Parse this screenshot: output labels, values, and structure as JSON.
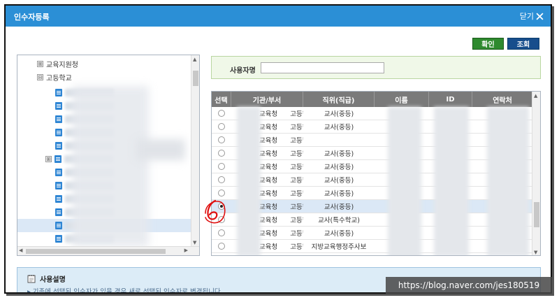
{
  "window": {
    "title": "인수자등록",
    "close_label": "닫기"
  },
  "buttons": {
    "confirm": "확인",
    "search": "조회"
  },
  "tree": {
    "items": [
      {
        "label": "교육지원청",
        "expander": "⊞"
      },
      {
        "label": "고등학교",
        "expander": "⊟"
      }
    ],
    "sub_expander": "⊞"
  },
  "search": {
    "label": "사용자명",
    "value": ""
  },
  "grid": {
    "columns": [
      "선택",
      "기관/부서",
      "직위(직급)",
      "이름",
      "ID",
      "연락처"
    ],
    "rows": [
      {
        "selected": false,
        "org1": "교육청",
        "org2": "고등학",
        "position": "교사(중등)"
      },
      {
        "selected": false,
        "org1": "교육청",
        "org2": "고등학",
        "position": "교사(중등)"
      },
      {
        "selected": false,
        "org1": "교육청",
        "org2": "고등학",
        "position": ""
      },
      {
        "selected": false,
        "org1": "교육청",
        "org2": "고등학",
        "position": "교사(중등)"
      },
      {
        "selected": false,
        "org1": "교육청",
        "org2": "고등학",
        "position": "교사(중등)"
      },
      {
        "selected": false,
        "org1": "교육청",
        "org2": "고등학",
        "position": "교사(중등)"
      },
      {
        "selected": false,
        "org1": "교육청",
        "org2": "고등학",
        "position": "교사(중등)"
      },
      {
        "selected": true,
        "org1": "교육청",
        "org2": "고등학",
        "position": "교사(중등)"
      },
      {
        "selected": false,
        "org1": "교육청",
        "org2": "고등학",
        "position": "교사(특수학교)"
      },
      {
        "selected": false,
        "org1": "교육청",
        "org2": "고등학",
        "position": "교사(중등)"
      },
      {
        "selected": false,
        "org1": "교육청",
        "org2": "고등학",
        "position": "지방교육행정주사보"
      }
    ]
  },
  "annotation": {
    "text": "6"
  },
  "usage": {
    "title": "사용설명",
    "description": "기존에 선택된 인수자가 있을 경우 새로 선택된 인수자로 변경됩니다"
  },
  "watermark": "https://blog.naver.com/jes180519",
  "colors": {
    "titlebar": "#2b8fd6",
    "confirm": "#2f8a2f",
    "search": "#174e8c",
    "grid_header": "#7a7a7a",
    "selection": "#dbe8f6",
    "annotation": "#e01010"
  }
}
